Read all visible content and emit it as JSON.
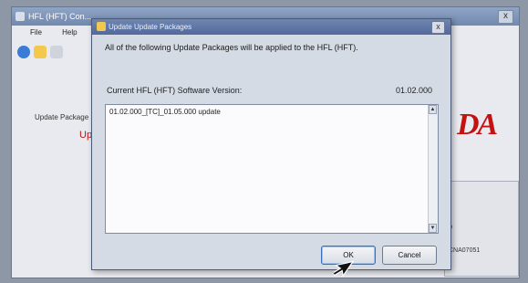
{
  "app": {
    "title": "HFL (HFT) Con...",
    "close_glyph": "x",
    "menu": [
      "File",
      "Help"
    ],
    "left_label": "Update Package",
    "left_red_text": "Up",
    "honda_mark": "DA",
    "right_text_1": "0",
    "right_text_2": "CNA07051"
  },
  "dialog": {
    "title": "Update Update Packages",
    "close_glyph": "x",
    "header": "All of the following Update Packages will be applied to the HFL (HFT).",
    "version_label": "Current HFL (HFT) Software Version:",
    "version_value": "01.02.000",
    "list_items": [
      "01.02.000_[TC]_01.05.000 update"
    ],
    "ok_label": "OK",
    "cancel_label": "Cancel"
  },
  "colors": {
    "brand_red": "#c41212",
    "title_bar": "#5c72a3"
  },
  "icons": {
    "app_toolbar": [
      "bluetooth-icon",
      "folder-icon",
      "document-icon"
    ],
    "cursor": "mouse-pointer-icon"
  }
}
